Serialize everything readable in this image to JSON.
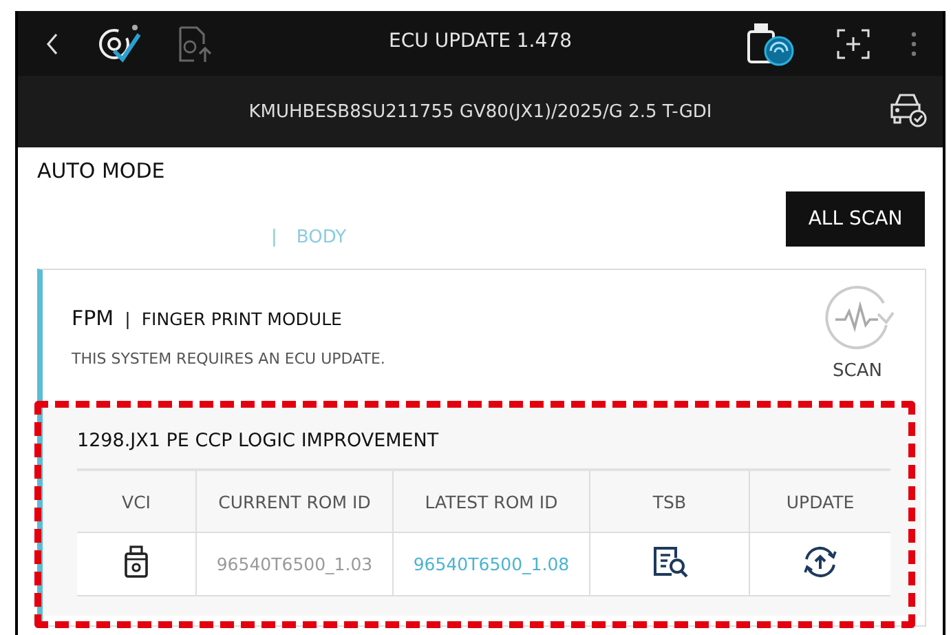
{
  "header": {
    "title": "ECU UPDATE 1.478"
  },
  "vehicle": {
    "info": "KMUHBESB8SU211755  GV80(JX1)/2025/G 2.5 T-GDI"
  },
  "mode": {
    "title": "AUTO MODE",
    "separator": "|",
    "tabs": [
      {
        "label": "BODY"
      }
    ],
    "scan_button": "ALL SCAN"
  },
  "system": {
    "code": "FPM",
    "separator": "|",
    "name": "FINGER PRINT MODULE",
    "message": "THIS SYSTEM REQUIRES AN ECU UPDATE.",
    "scan_label": "SCAN",
    "update": {
      "title": "1298.JX1 PE CCP LOGIC IMPROVEMENT",
      "highlighted": true,
      "columns": [
        "VCI",
        "CURRENT ROM ID",
        "LATEST ROM ID",
        "TSB",
        "UPDATE"
      ],
      "row": [
        {
          "kind": "vci-icon"
        },
        {
          "kind": "text",
          "text": "96540T6500_1.03"
        },
        {
          "kind": "link",
          "text": "96540T6500_1.08"
        },
        {
          "kind": "tsb-icon"
        },
        {
          "kind": "update-icon"
        }
      ]
    }
  }
}
